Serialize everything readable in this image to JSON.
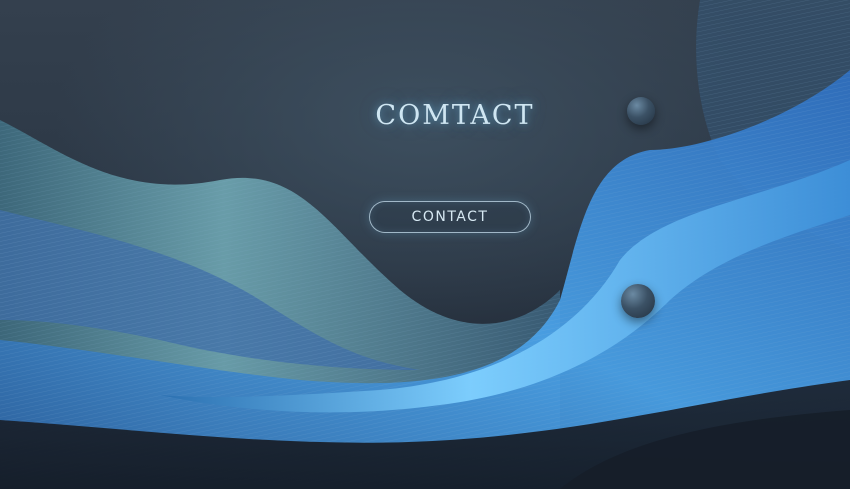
{
  "hero": {
    "heading": "COMTACT",
    "button_label": "CONTACT"
  },
  "decor": {
    "orbs": [
      "orb-top",
      "orb-bottom"
    ],
    "colors": {
      "background": "#2a3542",
      "wave_teal": "#5fa9b8",
      "wave_blue": "#3f8fe0",
      "glow": "#8fd3ff"
    }
  }
}
